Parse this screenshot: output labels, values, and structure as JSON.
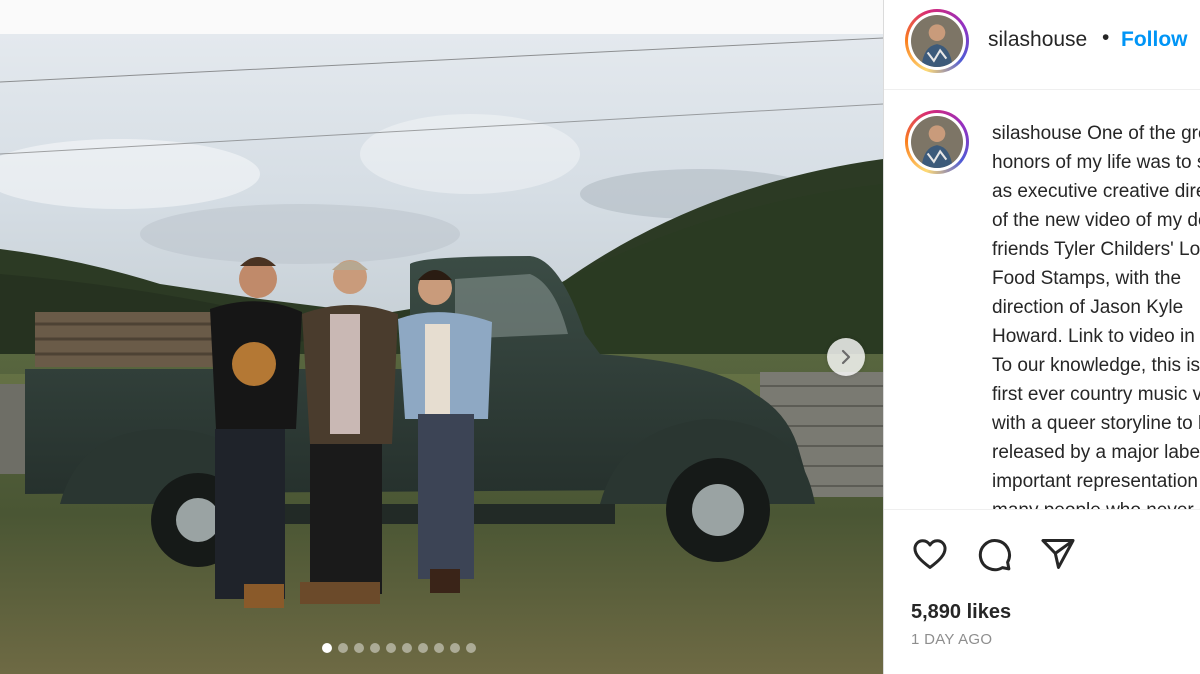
{
  "post": {
    "media": {
      "slide_count": 10,
      "active_slide": 1,
      "next_icon": "chevron-right-icon"
    },
    "author": {
      "username": "silashouse",
      "separator": "•",
      "follow_label": "Follow"
    },
    "caption": {
      "username": "silashouse",
      "text": "One of the greatest honors of my life was to serve as executive creative director of the new video of my dear friends Tyler Childers' Long Food Stamps, with the direction of Jason Kyle Howard. Link to video in bio. To our knowledge, this is the first ever country music video with a queer storyline to be released by a major label. It is important representation for so many people who never get to see themselves in a country music video. But more than anything, it is a"
    },
    "actions": {
      "like_icon": "heart-icon",
      "comment_icon": "comment-icon",
      "share_icon": "paper-plane-icon"
    },
    "likes": "5,890 likes",
    "time_ago": "1 DAY AGO"
  },
  "colors": {
    "follow_blue": "#0095f6",
    "secondary_text": "#8e8e8e",
    "border": "#dbdbdb"
  }
}
